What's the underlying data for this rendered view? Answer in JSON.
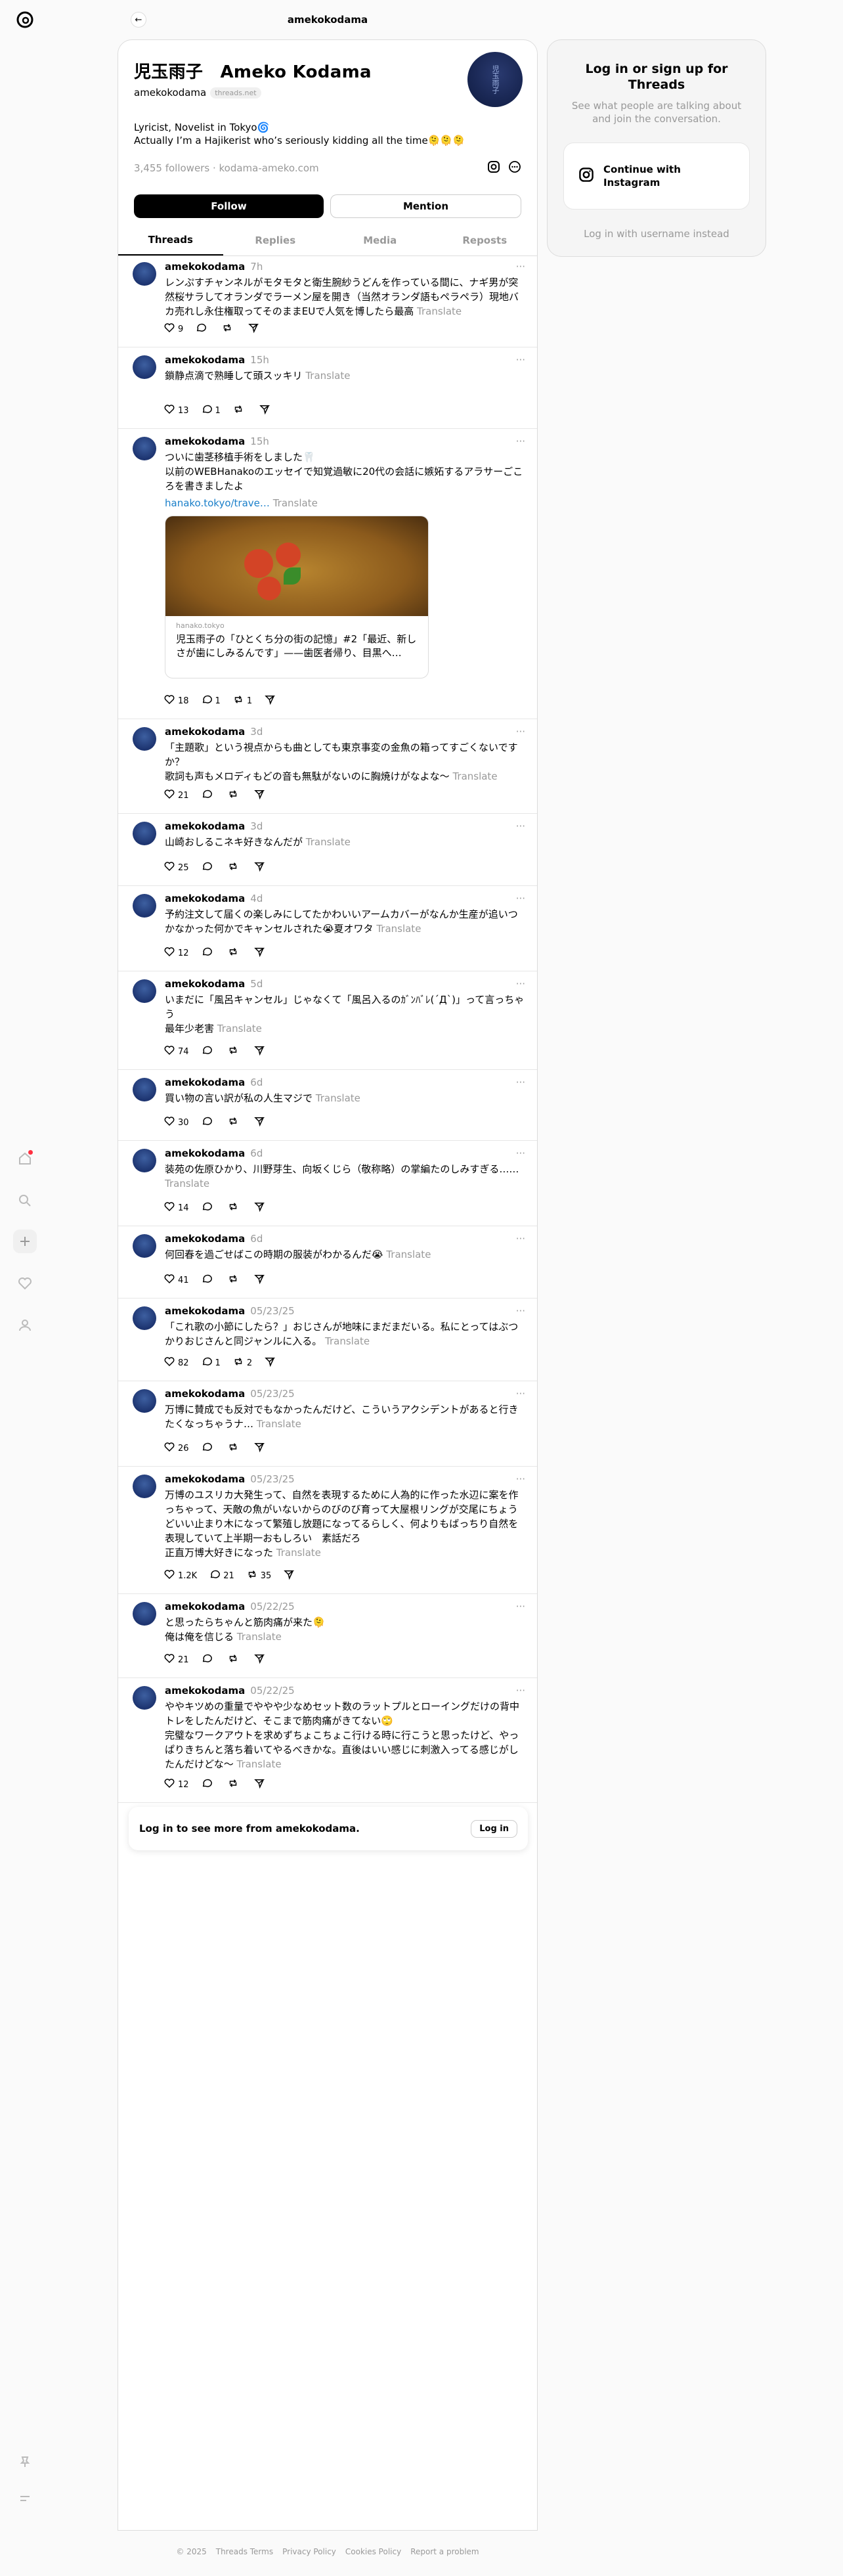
{
  "header": {
    "title": "amekokodama"
  },
  "profile": {
    "name": "児玉雨子　Ameko Kodama",
    "username": "amekokodama",
    "domain_pill": "threads.net",
    "bio_line1": "Lyricist, Novelist in Tokyo🌀",
    "bio_line2": "Actually I’m a Hajikerist who’s seriously kidding all the time🫠🫠🫠",
    "followers": "3,455 followers",
    "link": "kodama-ameko.com",
    "avatar_text": "児玉雨子"
  },
  "buttons": {
    "follow": "Follow",
    "mention": "Mention"
  },
  "tabs": [
    {
      "label": "Threads"
    },
    {
      "label": "Replies"
    },
    {
      "label": "Media"
    },
    {
      "label": "Reposts"
    }
  ],
  "translate_label": "Translate",
  "posts": [
    {
      "user": "amekokodama",
      "time": "7h",
      "text": "レンぷすチャンネルがモタモタと衛生腕紗うどんを作っている間に、ナギ男が突然桜サラしてオランダでラーメン屋を開き（当然オランダ語もペラペラ）現地バカ売れし永住権取ってそのままEUで人気を博したら最高",
      "likes": "9",
      "replies": "",
      "reposts": ""
    },
    {
      "user": "amekokodama",
      "time": "15h",
      "text": "鎖静点滴で熟睡して頭スッキリ",
      "likes": "13",
      "replies": "1",
      "reposts": ""
    },
    {
      "user": "amekokodama",
      "time": "15h",
      "text": "ついに歯茎移植手術をしました🦷\n以前のWEBHanakoのエッセイで知覚過敏に20代の会話に嫉妬するアラサーごころを書きましたよ",
      "link": "hanako.tokyo/trave…",
      "likes": "18",
      "replies": "1",
      "reposts": "1",
      "preview": {
        "source": "hanako.tokyo",
        "title": "児玉雨子の「ひとくち分の街の記憶」#2「最近、新しさが歯にしみるんです」——歯医者帰り、目黒へ…"
      }
    },
    {
      "user": "amekokodama",
      "time": "3d",
      "text": "「主題歌」という視点からも曲としても東京事変の金魚の箱ってすごくないですか？\n歌詞も声もメロディもどの音も無駄がないのに胸焼けがなよな〜",
      "likes": "21",
      "replies": "",
      "reposts": ""
    },
    {
      "user": "amekokodama",
      "time": "3d",
      "text": "山崎おしるこネキ好きなんだが",
      "likes": "25",
      "replies": "",
      "reposts": ""
    },
    {
      "user": "amekokodama",
      "time": "4d",
      "text": "予約注文して届くの楽しみにしてたかわいいアームカバーがなんか生産が追いつかなかった何かでキャンセルされた😭夏オワタ",
      "likes": "12",
      "replies": "",
      "reposts": ""
    },
    {
      "user": "amekokodama",
      "time": "5d",
      "text": "いまだに「風呂キャンセル」じゃなくて「風呂入るのｶﾞﾝﾊﾞﾚ(´Д`)」って言っちゃう\n最年少老害",
      "likes": "74",
      "replies": "",
      "reposts": ""
    },
    {
      "user": "amekokodama",
      "time": "6d",
      "text": "買い物の言い訳が私の人生マジで",
      "likes": "30",
      "replies": "",
      "reposts": ""
    },
    {
      "user": "amekokodama",
      "time": "6d",
      "text": "装苑の佐原ひかり、川野芽生、向坂くじら（敬称略）の掌編たのしみすぎる……",
      "likes": "14",
      "replies": "",
      "reposts": ""
    },
    {
      "user": "amekokodama",
      "time": "6d",
      "text": "何回春を過ごせばこの時期の服装がわかるんだ😭",
      "likes": "41",
      "replies": "",
      "reposts": ""
    },
    {
      "user": "amekokodama",
      "time": "05/23/25",
      "text": "「これ歌の小節にしたら？」おじさんが地味にまだまだいる。私にとってはぶつかりおじさんと同ジャンルに入る。",
      "likes": "82",
      "replies": "1",
      "reposts": "2"
    },
    {
      "user": "amekokodama",
      "time": "05/23/25",
      "text": "万博に賛成でも反対でもなかったんだけど、こういうアクシデントがあると行きたくなっちゃうナ…",
      "likes": "26",
      "replies": "",
      "reposts": ""
    },
    {
      "user": "amekokodama",
      "time": "05/23/25",
      "text": "万博のユスリカ大発生って、自然を表現するために人為的に作った水辺に案を作っちゃって、天敵の魚がいないからのびのび育って大屋根リングが交尾にちょうどいい止まり木になって繁殖し放題になってるらしく、何よりもばっちり自然を表現していて上半期一おもしろい　素話だろ\n正直万博大好きになった",
      "likes": "1.2K",
      "replies": "21",
      "reposts": "35"
    },
    {
      "user": "amekokodama",
      "time": "05/22/25",
      "text": "と思ったらちゃんと筋肉痛が来た🫠\n俺は俺を信じる",
      "likes": "21",
      "replies": "",
      "reposts": ""
    },
    {
      "user": "amekokodama",
      "time": "05/22/25",
      "text": "ややキツめの重量でややや少なめセット数のラットプルとローイングだけの背中トレをしたんだけど、そこまで筋肉痛がきてない🙄\n完璧なワークアウトを求めずちょこちょこ行ける時に行こうと思ったけど、やっぱりきちんと落ち着いてやるべきかな。直後はいい感じに刺激入ってる感じがしたんだけどな〜",
      "likes": "12",
      "replies": "",
      "reposts": ""
    }
  ],
  "banner": {
    "text": "Log in to see more from amekokodama.",
    "button": "Log in"
  },
  "side": {
    "heading": "Log in or sign up for Threads",
    "sub": "See what people are talking about and join the conversation.",
    "instagram": "Continue with Instagram",
    "username_login": "Log in with username instead"
  },
  "footer": [
    "© 2025",
    "Threads Terms",
    "Privacy Policy",
    "Cookies Policy",
    "Report a problem"
  ]
}
